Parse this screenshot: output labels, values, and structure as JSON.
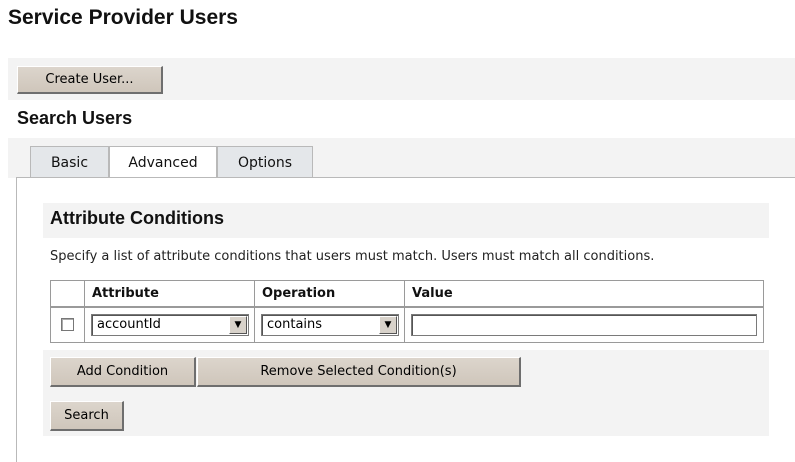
{
  "page": {
    "title": "Service Provider Users"
  },
  "toolbar": {
    "create_user_label": "Create User..."
  },
  "search": {
    "section_title": "Search Users",
    "tabs": [
      {
        "label": "Basic",
        "active": false
      },
      {
        "label": "Advanced",
        "active": true
      },
      {
        "label": "Options",
        "active": false
      }
    ]
  },
  "conditions": {
    "heading": "Attribute Conditions",
    "instructions": "Specify a list of attribute conditions that users must match. Users must match all conditions.",
    "columns": {
      "attribute": "Attribute",
      "operation": "Operation",
      "value": "Value"
    },
    "rows": [
      {
        "checked": false,
        "attribute": "accountId",
        "operation": "contains",
        "value": ""
      }
    ],
    "add_condition_label": "Add Condition",
    "remove_selected_label": "Remove Selected Condition(s)",
    "search_label": "Search"
  },
  "icons": {
    "dropdown": "chevron-down-icon"
  },
  "colors": {
    "button_face": "#d4ccc2",
    "strip_background": "#f3f3f3",
    "tab_background": "#e4e7ea",
    "border": "#9a9a9a"
  }
}
